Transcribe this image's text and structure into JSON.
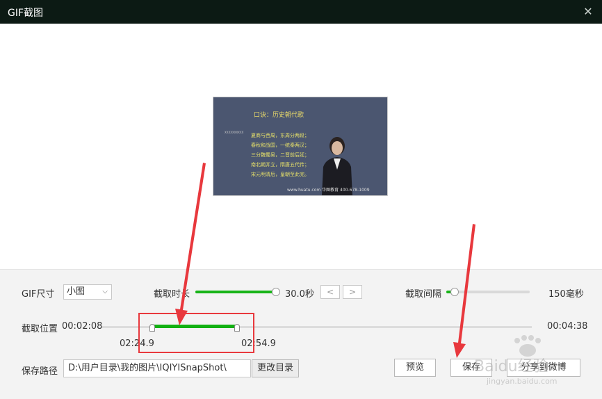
{
  "window": {
    "title": "GIF截图",
    "close_icon": "close-icon"
  },
  "preview": {
    "thumbnail": {
      "heading": "口诀：历史朝代歌",
      "side_text": "XXXXXXXXXX",
      "lines": [
        "夏商与西周，东周分两段；",
        "春秋和战国，一统秦两汉；",
        "三分魏蜀吴，二晋前后延；",
        "南北朝并立，隋唐五代传；",
        "宋元明清后，皇朝至此完。"
      ],
      "footer": "www.huatu.com  华图教育  400-678-1009"
    }
  },
  "controls": {
    "size_label": "GIF尺寸",
    "size_value": "小图",
    "duration_label": "截取时长",
    "duration_value": "30.0秒",
    "duration_fraction": 0.98,
    "prev_label": "<",
    "next_label": ">",
    "interval_label": "截取间隔",
    "interval_value": "150毫秒",
    "interval_fraction": 0.1,
    "position_label": "截取位置",
    "position_start": "00:02:08",
    "position_end": "00:04:38",
    "range_start": "02:24.9",
    "range_end": "02:54.9",
    "path_label": "保存路径",
    "path_value": "D:\\用户目录\\我的图片\\IQIYISnapShot\\",
    "change_dir_label": "更改目录",
    "preview_label": "预览",
    "save_label": "保存",
    "share_label": "分享到微博"
  },
  "watermark": {
    "brand": "Baidu经验",
    "url": "jingyan.baidu.com"
  },
  "colors": {
    "titlebar": "#0c1a14",
    "accent": "#18b418",
    "annotation": "#e8383d"
  }
}
